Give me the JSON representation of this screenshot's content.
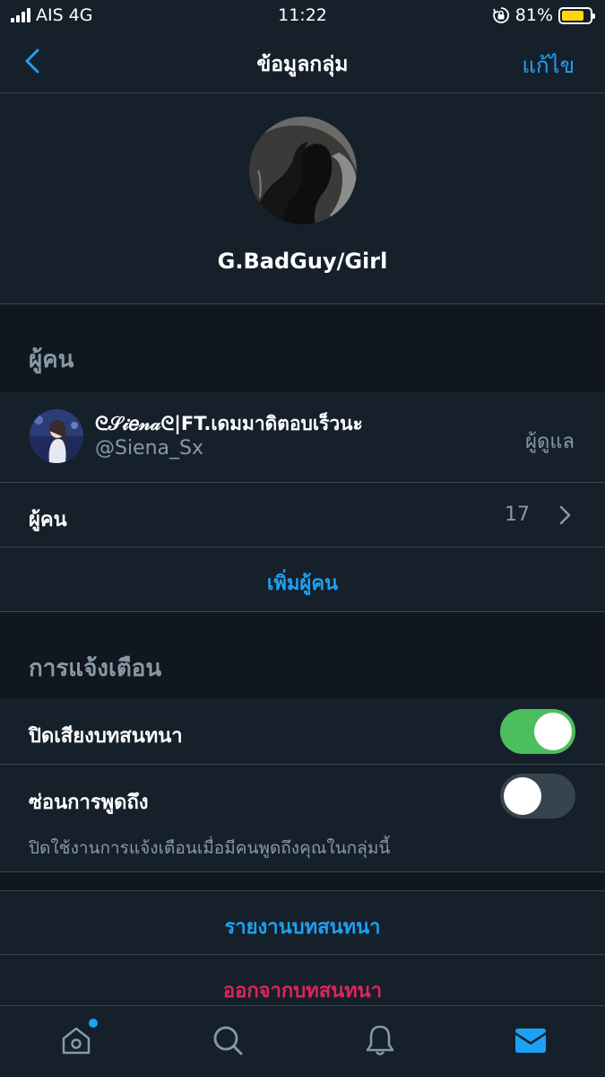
{
  "status_bar": {
    "carrier": "AIS",
    "network": "4G",
    "time": "11:22",
    "battery": "81%",
    "battery_level": 0.81
  },
  "nav": {
    "title": "ข้อมูลกลุ่ม",
    "edit_label": "แก้ไข",
    "back_icon": "chevron-left-icon"
  },
  "group": {
    "name": "G.BadGuy/Girl"
  },
  "people_section": {
    "title": "ผู้คน",
    "member": {
      "display_name": "ᘓ𝒮𝒾𝑒𝓃𝒶ᘓ|FT.เดมมาดิตอบเร็วนะ",
      "handle": "@Siena_Sx",
      "role": "ผู้ดูแล"
    },
    "people_row_label": "ผู้คน",
    "people_count": "17",
    "add_people_label": "เพิ่มผู้คน"
  },
  "notifications_section": {
    "title": "การแจ้งเตือน",
    "mute_label": "ปิดเสียงบทสนทนา",
    "mute_on": true,
    "hide_mentions_label": "ซ่อนการพูดถึง",
    "hide_mentions_on": false,
    "hide_mentions_hint": "ปิดใช้งานการแจ้งเตือนเมื่อมีคนพูดถึงคุณในกลุ่มนี้"
  },
  "actions": {
    "report_label": "รายงานบทสนทนา",
    "leave_label": "ออกจากบทสนทนา"
  },
  "tab_bar": {
    "tabs": [
      "home-icon",
      "search-icon",
      "bell-icon",
      "mail-icon"
    ],
    "active": "mail-icon"
  },
  "colors": {
    "background": "#15202b",
    "accent": "#1da1f2",
    "danger": "#e0245e",
    "toggle_on": "#4cbe5e",
    "muted_text": "#8899a6"
  }
}
